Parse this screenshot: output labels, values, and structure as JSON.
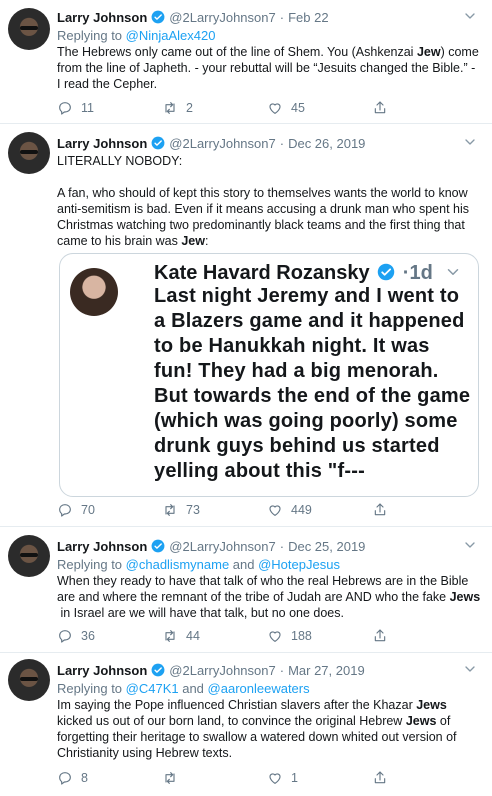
{
  "tweets": [
    {
      "name": "Larry Johnson",
      "handle": "@2LarryJohnson7",
      "date": "Feb 22",
      "reply_prefix": "Replying to ",
      "reply_to": "@NinjaAlex420",
      "text_parts": [
        "The Hebrews only came out of the line of Shem. You (Ashkenzai ",
        "Jew",
        ") come from the line of Japheth. - your rebuttal will be “Jesuits changed the Bible.” - I read the Cepher."
      ],
      "replies": "11",
      "retweets": "2",
      "likes": "45"
    },
    {
      "name": "Larry Johnson",
      "handle": "@2LarryJohnson7",
      "date": "Dec 26, 2019",
      "text_parts": [
        "LITERALLY NOBODY:\n\nA fan, who should of kept this story to themselves wants the world to know anti-semitism is bad. Even if it means accusing a drunk man who spent his Christmas watching two predominantly black teams and the first thing that came to his brain was ",
        "Jew",
        ":"
      ],
      "replies": "70",
      "retweets": "73",
      "likes": "449",
      "quote": {
        "name": "Kate Havard Rozansky",
        "age": "1d",
        "text": "Last night Jeremy and I went to a Blazers game and it happened to be Hanukkah night. It was fun! They had a  big menorah. But towards the end of the game (which was going poorly) some drunk guys behind us started yelling about this \"f---"
      }
    },
    {
      "name": "Larry Johnson",
      "handle": "@2LarryJohnson7",
      "date": "Dec 25, 2019",
      "reply_prefix": "Replying to ",
      "reply_to": "@chadlismyname",
      "reply_and": " and ",
      "reply_to2": "@HotepJesus",
      "text_parts": [
        "When they ready to have that talk of who the real Hebrews are in the Bible are and where the remnant of the tribe of Judah are AND who the fake ",
        "Jews",
        "\n in Israel are we will have that talk, but no one does."
      ],
      "replies": "36",
      "retweets": "44",
      "likes": "188"
    },
    {
      "name": "Larry Johnson",
      "handle": "@2LarryJohnson7",
      "date": "Mar 27, 2019",
      "reply_prefix": "Replying to ",
      "reply_to": "@C47K1",
      "reply_and": " and ",
      "reply_to2": "@aaronleewaters",
      "text_parts": [
        "Im saying the Pope influenced Christian slavers after the Khazar ",
        "Jews",
        " kicked us out of our born land, to convince the original Hebrew ",
        "Jews",
        " of forgetting their heritage to swallow a watered down whited out version of Christianity using Hebrew texts."
      ],
      "replies": "8",
      "retweets": "",
      "likes": "1"
    }
  ],
  "colors": {
    "accent": "#1da1f2",
    "muted": "#657786",
    "text": "#14171a",
    "border": "#e6ecf0"
  },
  "icons": [
    "verified-badge-icon",
    "chevron-down-icon",
    "reply-icon",
    "retweet-icon",
    "like-icon",
    "share-icon"
  ]
}
